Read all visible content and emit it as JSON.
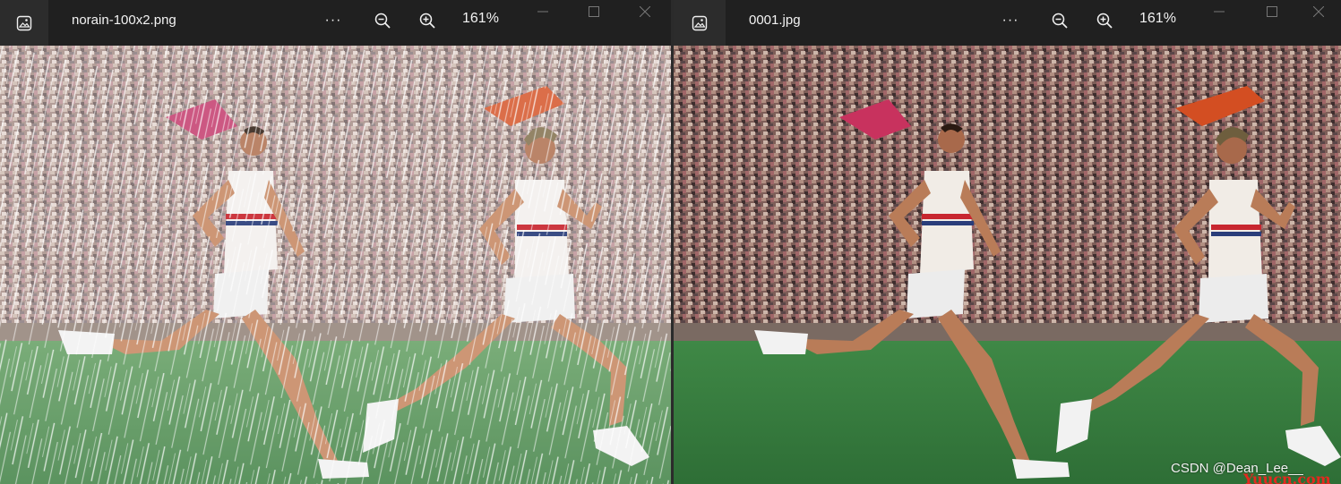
{
  "left_window": {
    "file_name": "norain-100x2.png",
    "more_label": "···",
    "zoom_out_icon": "zoom-out-icon",
    "zoom_in_icon": "zoom-in-icon",
    "zoom_level": "161%",
    "image_content": "rainy photo of two runners on a track with crowd",
    "app_icon": "photo-viewer-icon"
  },
  "right_window": {
    "file_name": "0001.jpg",
    "more_label": "···",
    "zoom_out_icon": "zoom-out-icon",
    "zoom_in_icon": "zoom-in-icon",
    "zoom_level": "161%",
    "image_content": "derained photo of two runners on a track with crowd",
    "app_icon": "photo-viewer-icon"
  },
  "watermarks": {
    "site": "Yuucn.com",
    "author": "CSDN @Dean_Lee__"
  },
  "colors": {
    "titlebar": "#202020",
    "grass": "#3f7a43",
    "watermark_red": "#e4291f"
  }
}
